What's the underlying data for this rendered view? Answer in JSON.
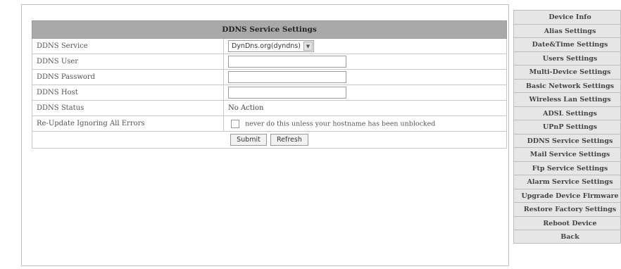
{
  "panel": {
    "title": "DDNS Service Settings",
    "rows": {
      "service": {
        "label": "DDNS Service",
        "value": "DynDns.org(dyndns)"
      },
      "user": {
        "label": "DDNS User",
        "value": ""
      },
      "password": {
        "label": "DDNS Password",
        "value": ""
      },
      "host": {
        "label": "DDNS Host",
        "value": ""
      },
      "status": {
        "label": "DDNS Status",
        "value": "No Action"
      },
      "reupdate": {
        "label": "Re-Update Ignoring All Errors",
        "checkbox_text": "never do this unless your hostname has been unblocked",
        "checked": false
      }
    },
    "buttons": {
      "submit": "Submit",
      "refresh": "Refresh"
    }
  },
  "menu": {
    "items": [
      "Device Info",
      "Alias Settings",
      "Date&Time Settings",
      "Users Settings",
      "Multi-Device Settings",
      "Basic Network Settings",
      "Wireless Lan Settings",
      "ADSL Settings",
      "UPnP Settings",
      "DDNS Service Settings",
      "Mail Service Settings",
      "Ftp Service Settings",
      "Alarm Service Settings",
      "Upgrade Device Firmware",
      "Restore Factory Settings",
      "Reboot Device",
      "Back"
    ]
  }
}
